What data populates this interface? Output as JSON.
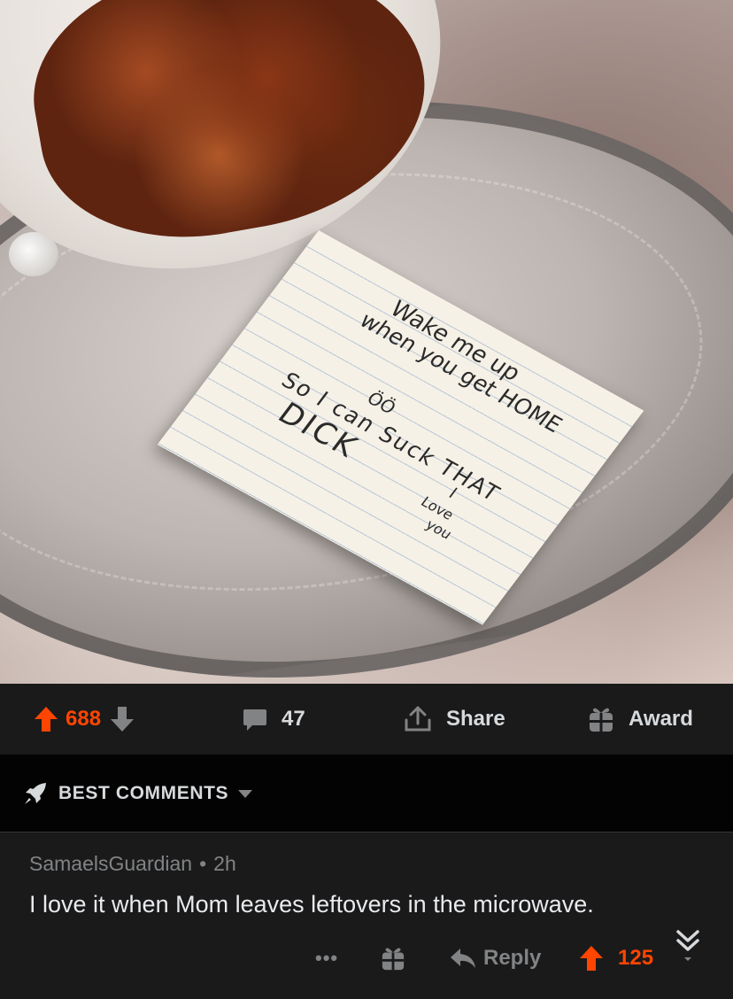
{
  "image": {
    "note_lines": [
      "Wake me up",
      "when you get HOME",
      "So I can Suck THAT",
      "DICK",
      "I",
      "Love",
      "you",
      "ÖÖ"
    ]
  },
  "action_bar": {
    "upvotes": "688",
    "comments": "47",
    "share_label": "Share",
    "award_label": "Award"
  },
  "sort": {
    "label": "BEST COMMENTS"
  },
  "comment": {
    "author": "SamaelsGuardian",
    "separator": "•",
    "age": "2h",
    "body": "I love it when Mom leaves leftovers in the microwave.",
    "more": "•••",
    "reply_label": "Reply",
    "upvotes": "125"
  },
  "colors": {
    "accent": "#ff4500",
    "bar_bg": "#1a1a1b",
    "page_bg": "#030303",
    "meta_text": "#818384"
  }
}
